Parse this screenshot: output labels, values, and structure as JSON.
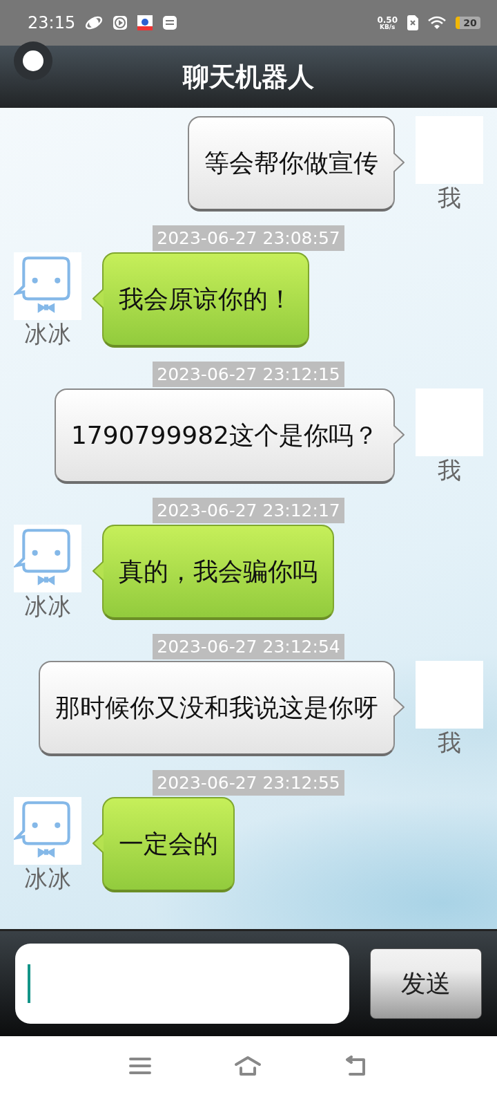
{
  "status_bar": {
    "time": "23:15",
    "net_speed": "0.50",
    "net_unit": "KB/s",
    "battery": "20"
  },
  "title": "聊天机器人",
  "messages": [
    {
      "kind": "me",
      "name": "我",
      "text": "等会帮你做宣传"
    },
    {
      "kind": "bot",
      "name": "冰冰",
      "timestamp": "2023-06-27 23:08:57",
      "text": "我会原谅你的！"
    },
    {
      "kind": "me",
      "name": "我",
      "timestamp": "2023-06-27 23:12:15",
      "text": "1790799982这个是你吗？"
    },
    {
      "kind": "bot",
      "name": "冰冰",
      "timestamp": "2023-06-27 23:12:17",
      "text": "真的，我会骗你吗"
    },
    {
      "kind": "me",
      "name": "我",
      "timestamp": "2023-06-27 23:12:54",
      "text": "那时候你又没和我说这是你呀"
    },
    {
      "kind": "bot",
      "name": "冰冰",
      "timestamp": "2023-06-27 23:12:55",
      "text": "一定会的"
    }
  ],
  "composer": {
    "send_label": "发送"
  }
}
